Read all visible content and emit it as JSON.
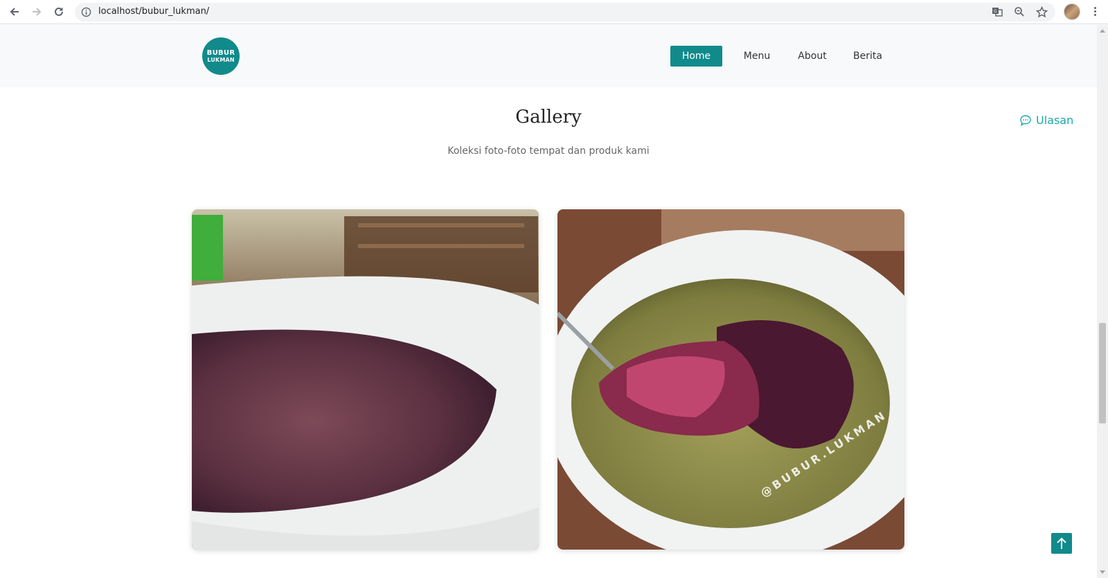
{
  "browser": {
    "url": "localhost/bubur_lukman/"
  },
  "site": {
    "logo_top": "BUBUR",
    "logo_bottom": "LUKMAN",
    "nav": [
      {
        "label": "Home",
        "active": true
      },
      {
        "label": "Menu",
        "active": false
      },
      {
        "label": "About",
        "active": false
      },
      {
        "label": "Berita",
        "active": false
      }
    ],
    "accent_color": "#118a8c"
  },
  "gallery": {
    "title": "Gallery",
    "subtitle": "Koleksi foto-foto tempat dan produk kami",
    "photos": [
      {
        "name": "bubur ketan hitam bowl"
      },
      {
        "name": "bubur ketan hitam with spoon",
        "watermark": "@BUBUR.LUKMAN"
      }
    ]
  },
  "review_link": {
    "label": "Ulasan",
    "icon": "chat-bubble-icon"
  },
  "scroll_top": {
    "icon": "arrow-up-icon"
  }
}
